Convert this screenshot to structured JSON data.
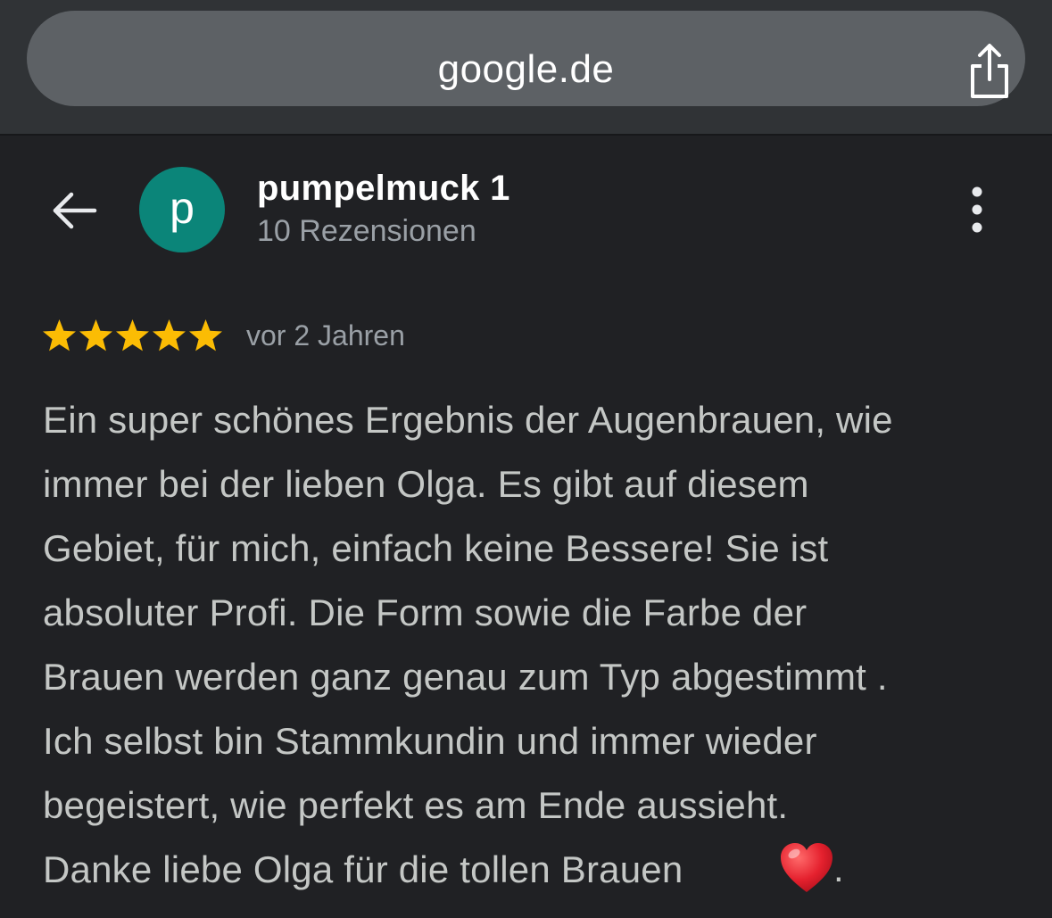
{
  "browser": {
    "url": "google.de",
    "share_icon": "share-icon"
  },
  "header": {
    "back_icon": "arrow-back-icon",
    "avatar_letter": "p",
    "avatar_color": "#0b8579",
    "reviewer_name": "pumpelmuck 1",
    "review_count": "10 Rezensionen",
    "more_icon": "more-vertical-icon"
  },
  "review": {
    "rating": 5,
    "rating_max": 5,
    "star_color": "#fbbc04",
    "date": "vor 2 Jahren",
    "text": "Ein super schönes Ergebnis der Augenbrauen, wie\nimmer bei der lieben Olga. Es gibt auf diesem\nGebiet, für mich, einfach keine Bessere! Sie ist\nabsoluter Profi. Die Form sowie die Farbe der\nBrauen werden ganz genau zum Typ abgestimmt .\nIch selbst bin Stammkundin und immer wieder\nbegeistert, wie perfekt es am Ende aussieht.\nDanke liebe Olga für die tollen Brauen",
    "text_end": ".",
    "emoji": "heart-icon"
  }
}
